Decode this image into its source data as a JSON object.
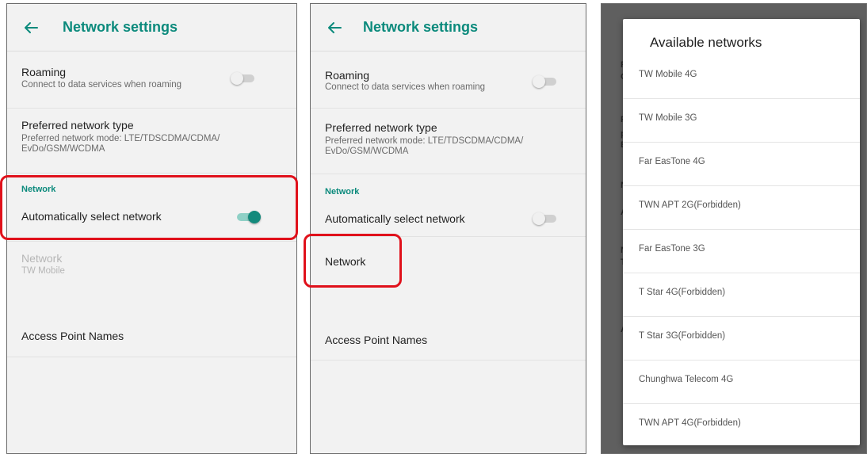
{
  "screen1": {
    "title": "Network settings",
    "roaming": {
      "title": "Roaming",
      "subtitle": "Connect to data services when roaming",
      "enabled": false
    },
    "preferred": {
      "title": "Preferred network type",
      "subtitle_line1": "Preferred network mode: LTE/TDSCDMA/CDMA/",
      "subtitle_line2": "EvDo/GSM/WCDMA"
    },
    "section": "Network",
    "auto_select": {
      "title": "Automatically select network",
      "enabled": true
    },
    "network": {
      "title": "Network",
      "subtitle": "TW Mobile"
    },
    "apn": {
      "title": "Access Point Names"
    }
  },
  "screen2": {
    "title": "Network settings",
    "roaming": {
      "title": "Roaming",
      "subtitle": "Connect to data services when roaming",
      "enabled": false
    },
    "preferred": {
      "title": "Preferred network type",
      "subtitle_line1": "Preferred network mode: LTE/TDSCDMA/CDMA/",
      "subtitle_line2": "EvDo/GSM/WCDMA"
    },
    "section": "Network",
    "auto_select": {
      "title": "Automatically select network",
      "enabled": false
    },
    "network": {
      "title": "Network"
    },
    "apn": {
      "title": "Access Point Names"
    }
  },
  "screen3": {
    "background_letters": [
      "R",
      "C",
      "P",
      "p",
      "E",
      "N",
      "A",
      "N",
      "T",
      "A"
    ],
    "dialog_title": "Available networks",
    "networks": [
      "TW Mobile 4G",
      "TW Mobile 3G",
      "Far EasTone 4G",
      "TWN APT 2G(Forbidden)",
      "Far EasTone 3G",
      "T Star 4G(Forbidden)",
      "T Star 3G(Forbidden)",
      "Chunghwa Telecom 4G",
      "TWN APT 4G(Forbidden)"
    ]
  },
  "colors": {
    "accent": "#0b8a7c",
    "highlight": "#e0111b",
    "scrim": "#5f5f5f"
  },
  "icons": {
    "back": "arrow-left-icon"
  }
}
